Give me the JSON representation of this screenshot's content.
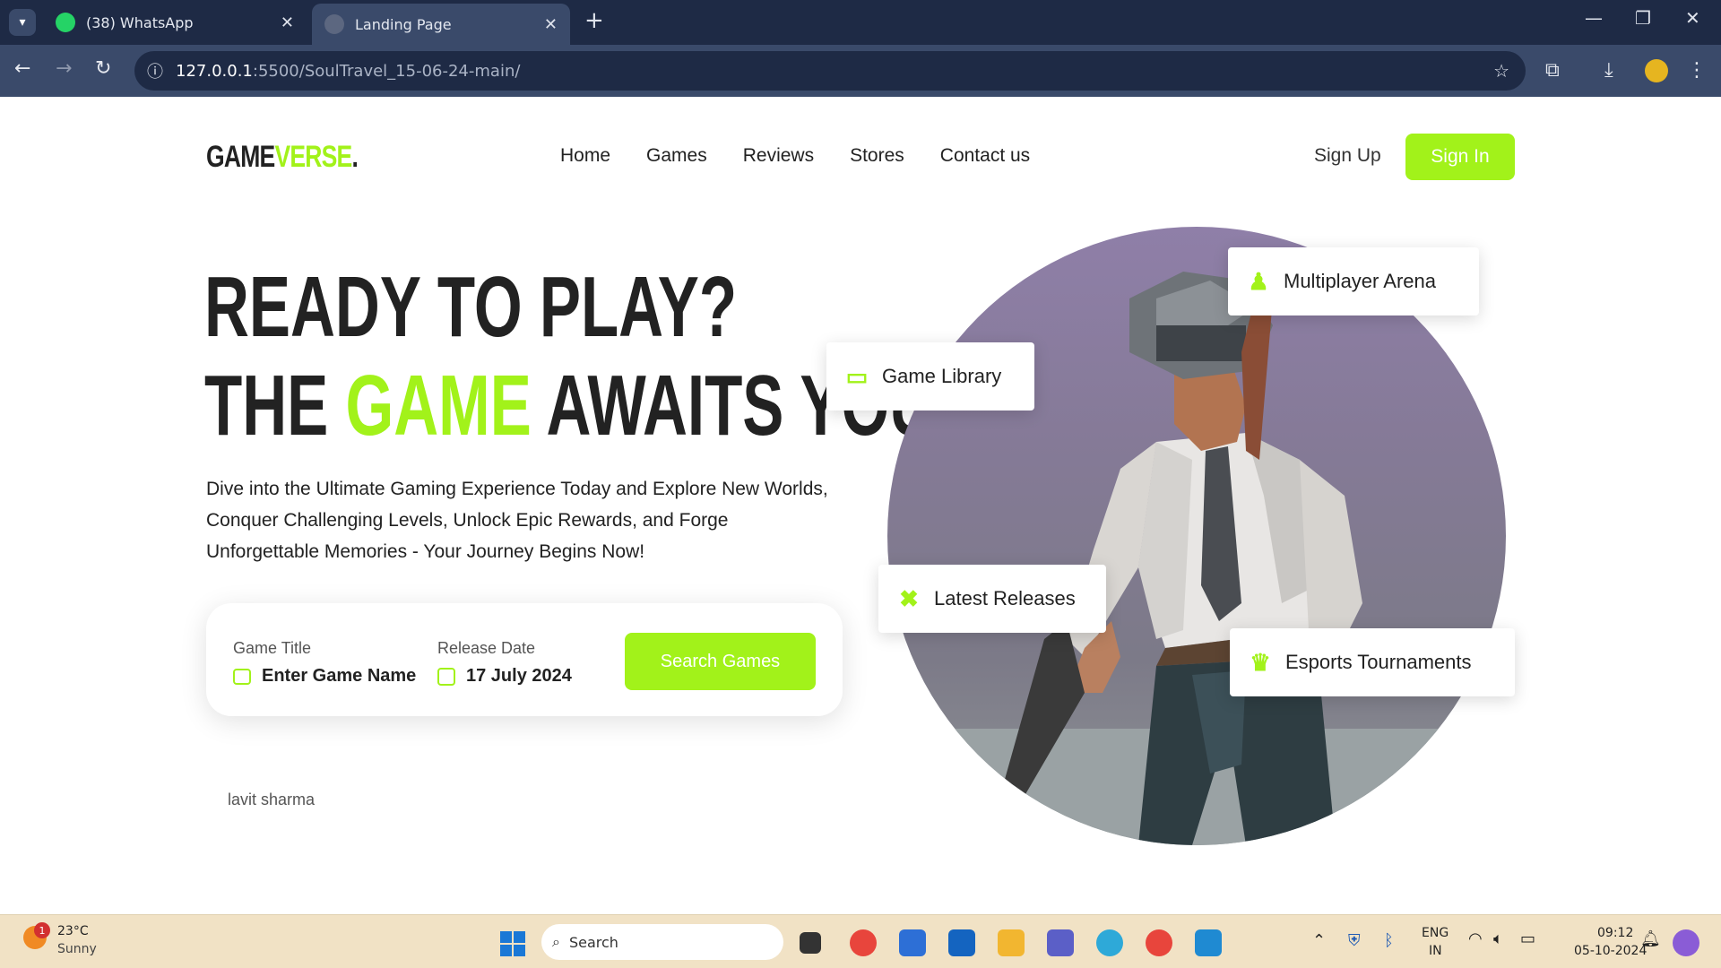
{
  "browser": {
    "tabs": [
      {
        "label": "(38) WhatsApp",
        "icon": "whatsapp-icon"
      },
      {
        "label": "Landing Page",
        "icon": "globe-icon"
      }
    ],
    "url_host": "127.0.0.1",
    "url_path": ":5500/SoulTravel_15-06-24-main/"
  },
  "site": {
    "logo_main": "GAME",
    "logo_accent": "VERSE",
    "logo_dot": ".",
    "nav": [
      "Home",
      "Games",
      "Reviews",
      "Stores",
      "Contact us"
    ],
    "signup": "Sign Up",
    "signin": "Sign In",
    "accent_color": "#a2f21a"
  },
  "hero": {
    "line1": "READY TO PLAY?",
    "line2_pre": "THE ",
    "line2_accent": "GAME",
    "line2_post": " AWAITS YOU",
    "description": "Dive into the Ultimate Gaming Experience Today and Explore New Worlds, Conquer Challenging Levels, Unlock Epic Rewards, and Forge Unforgettable Memories - Your Journey Begins Now!"
  },
  "search": {
    "title_label": "Game Title",
    "title_value": "Enter Game Name",
    "date_label": "Release Date",
    "date_value": "17 July 2024",
    "button": "Search Games"
  },
  "author": "lavit sharma",
  "badges": {
    "multiplayer": "Multiplayer Arena",
    "library": "Game Library",
    "releases": "Latest Releases",
    "esports": "Esports Tournaments"
  },
  "taskbar": {
    "temp": "23°C",
    "condition": "Sunny",
    "weather_badge": "1",
    "search": "Search",
    "lang1": "ENG",
    "lang2": "IN",
    "time": "09:12",
    "date": "05-10-2024"
  }
}
